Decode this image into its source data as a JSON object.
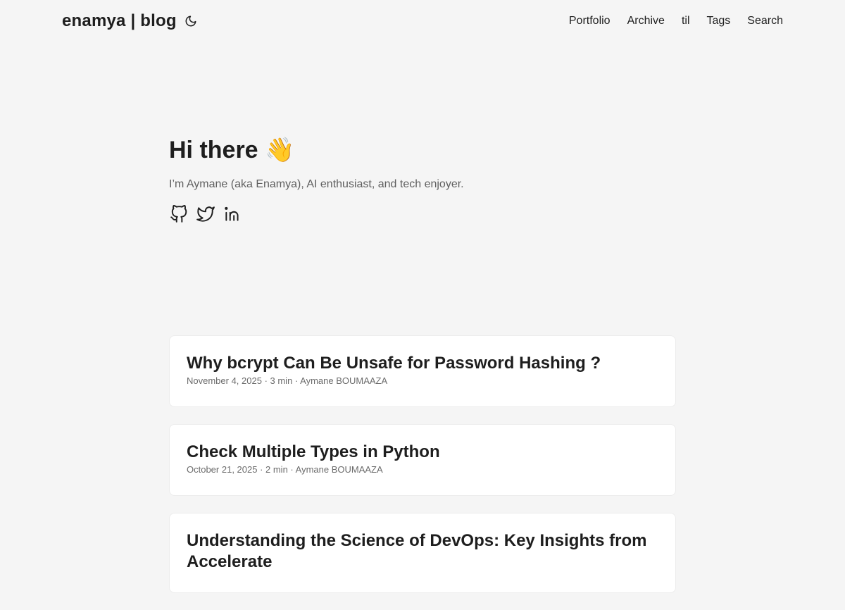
{
  "header": {
    "logo": "enamya | blog",
    "theme_icon": "moon-icon",
    "nav": [
      {
        "label": "Portfolio"
      },
      {
        "label": "Archive"
      },
      {
        "label": "til"
      },
      {
        "label": "Tags"
      },
      {
        "label": "Search"
      }
    ]
  },
  "hero": {
    "title": "Hi there 👋",
    "subtitle": "I’m Aymane (aka Enamya), AI enthusiast, and tech enjoyer.",
    "social_icons": [
      "github-icon",
      "twitter-icon",
      "linkedin-icon"
    ]
  },
  "posts": [
    {
      "title": "Why bcrypt Can Be Unsafe for Password Hashing ?",
      "meta": "November 4, 2025 · 3 min · Aymane BOUMAAZA"
    },
    {
      "title": "Check Multiple Types in Python",
      "meta": "October 21, 2025 · 2 min · Aymane BOUMAAZA"
    },
    {
      "title": "Understanding the Science of DevOps: Key Insights from Accelerate",
      "meta": ""
    }
  ]
}
